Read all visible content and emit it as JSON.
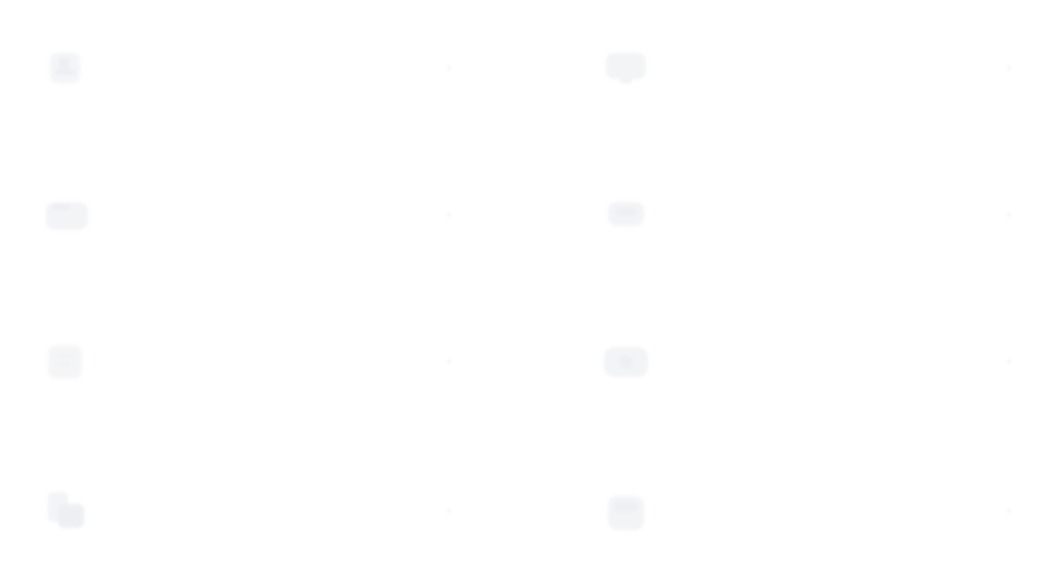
{
  "items": [
    {
      "label": "",
      "icon": "download-icon",
      "chevron": "›"
    },
    {
      "label": "",
      "icon": "monitor-icon",
      "chevron": "›"
    },
    {
      "label": "",
      "icon": "folder-icon",
      "chevron": "›"
    },
    {
      "label": "",
      "icon": "archive-icon",
      "chevron": "›"
    },
    {
      "label": "",
      "icon": "document-icon",
      "chevron": "›"
    },
    {
      "label": "",
      "icon": "image-icon",
      "chevron": "›"
    },
    {
      "label": "",
      "icon": "file-stack-icon",
      "chevron": "›"
    },
    {
      "label": "",
      "icon": "box-icon",
      "chevron": "›"
    }
  ],
  "colors": {
    "background": "#ffffff",
    "icon": "#f1f2f4",
    "text": "#e9eaec"
  }
}
